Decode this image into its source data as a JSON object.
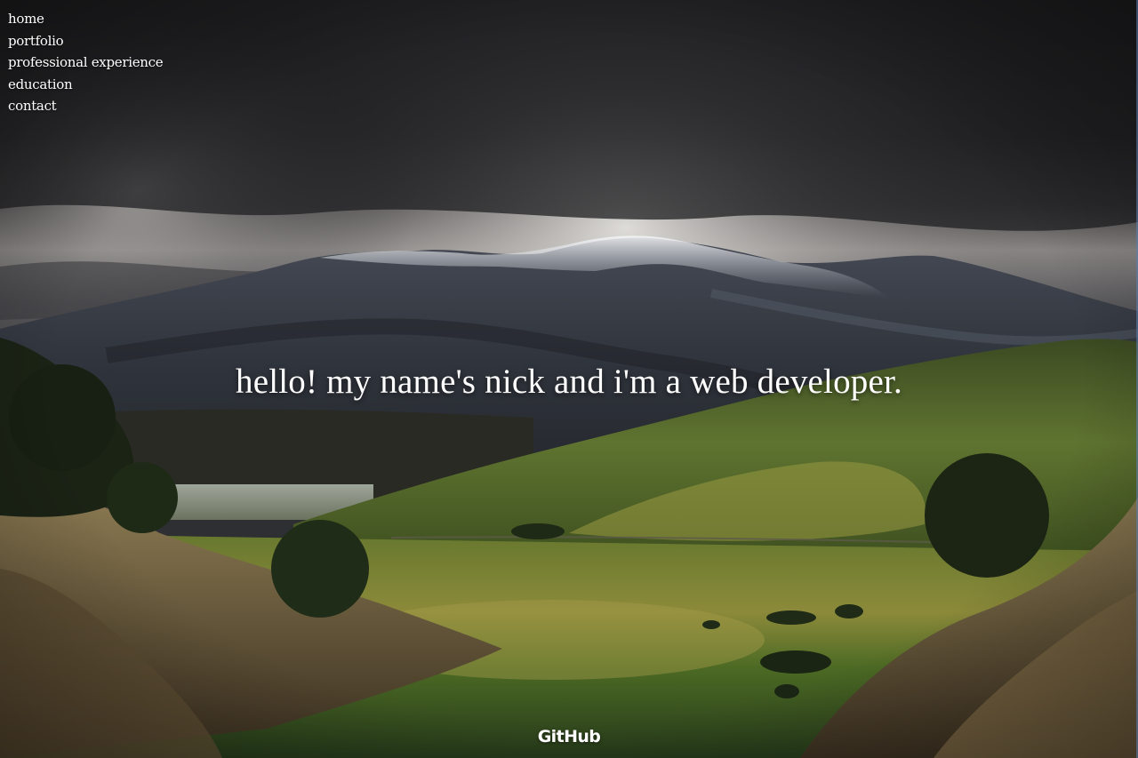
{
  "nav": {
    "items": [
      {
        "label": "home"
      },
      {
        "label": "portfolio"
      },
      {
        "label": "professional experience"
      },
      {
        "label": "education"
      },
      {
        "label": "contact"
      }
    ]
  },
  "hero": {
    "headline": "hello! my name's nick and i'm a web developer.",
    "background": "mountain-landscape-photo"
  },
  "footer": {
    "github_label": "GitHub"
  },
  "colors": {
    "text": "#ffffff",
    "sky_dark": "#1f1f22",
    "grass": "#4f6a2a",
    "snow": "#e6e8ec"
  }
}
